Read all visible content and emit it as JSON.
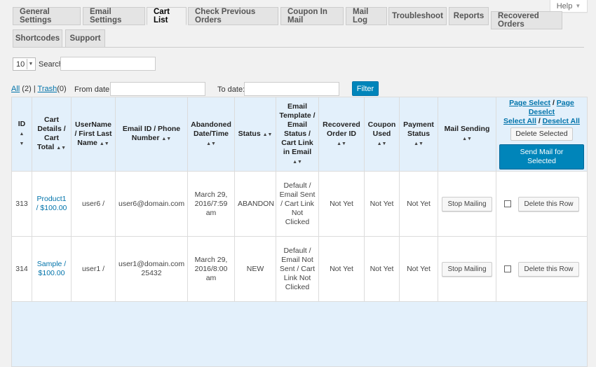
{
  "help": {
    "label": "Help"
  },
  "tabs": [
    {
      "label": "General Settings"
    },
    {
      "label": "Email Settings"
    },
    {
      "label": "Cart List"
    },
    {
      "label": "Check Previous Orders"
    },
    {
      "label": "Coupon In Mail"
    },
    {
      "label": "Mail Log"
    },
    {
      "label": "Troubleshoot"
    },
    {
      "label": "Reports"
    },
    {
      "label": "Recovered Orders"
    },
    {
      "label": "Shortcodes"
    },
    {
      "label": "Support"
    }
  ],
  "list_controls": {
    "per_page": "10",
    "search_label": "Search",
    "search_value": ""
  },
  "filters": {
    "all_label": "All",
    "all_count": "(2)",
    "separator": "|",
    "trash_label": "Trash",
    "trash_count": "(0)",
    "from_label": "From date:",
    "from_value": "",
    "to_label": "To date:",
    "to_value": "",
    "filter_button": "Filter"
  },
  "table": {
    "headers": {
      "id": "ID",
      "cart_details": "Cart Details / Cart Total",
      "username": "UserName / First Last Name",
      "email": "Email ID / Phone Number",
      "abandoned": "Abandoned Date/Time",
      "status": "Status",
      "email_template": "Email Template / Email Status / Cart Link in Email",
      "recovered": "Recovered Order ID",
      "coupon": "Coupon Used",
      "payment": "Payment Status",
      "mail_sending": "Mail Sending"
    },
    "actions_header": {
      "page_select": "Page Select",
      "slash1": "/",
      "page_deselect": "Page Deselct",
      "select_all": "Select All",
      "slash2": "/",
      "deselect_all": "Deselct All",
      "delete_selected": "Delete Selected",
      "send_mail": "Send Mail for Selected"
    },
    "rows": [
      {
        "id": "313",
        "cart": "Product1 / $100.00",
        "username": "user6 /",
        "email": "user6@domain.com",
        "abandoned": "March 29, 2016/7:59 am",
        "status": "ABANDON",
        "template": "Default / Email Sent / Cart Link Not Clicked",
        "recovered": "Not Yet",
        "coupon": "Not Yet",
        "payment": "Not Yet",
        "mail_btn": "Stop Mailing",
        "delete_btn": "Delete this Row"
      },
      {
        "id": "314",
        "cart": "Sample / $100.00",
        "username": "user1 /",
        "email": "user1@domain.com 25432",
        "abandoned": "March 29, 2016/8:00 am",
        "status": "NEW",
        "template": "Default / Email Not Sent / Cart Link Not Clicked",
        "recovered": "Not Yet",
        "coupon": "Not Yet",
        "payment": "Not Yet",
        "mail_btn": "Stop Mailing",
        "delete_btn": "Delete this Row"
      }
    ]
  },
  "colors": {
    "accent": "#0085ba",
    "link": "#0073aa",
    "header_bg": "#e3f0fb"
  }
}
